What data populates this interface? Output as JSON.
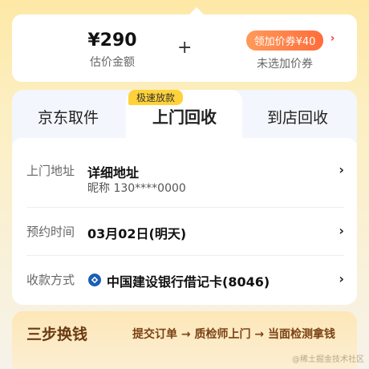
{
  "price": {
    "amount": "¥290",
    "amount_label": "估价金额",
    "plus": "+",
    "coupon_label": "领加价券¥40",
    "coupon_status": "未选加价券",
    "coupon_arrow": "›"
  },
  "tabs": [
    {
      "label": "京东取件"
    },
    {
      "label": "上门回收"
    },
    {
      "label": "到店回收"
    }
  ],
  "badge": "极速放款",
  "form": {
    "address": {
      "label": "上门地址",
      "value": "详细地址",
      "sub": "昵称 130****0000"
    },
    "time": {
      "label": "预约时间",
      "value": "03月02日(明天)"
    },
    "payment": {
      "label": "收款方式",
      "value": "中国建设银行借记卡(8046)"
    },
    "chevron": "›"
  },
  "steps": {
    "title": "三步换钱",
    "flow": "提交订单 → 质检师上门 → 当面检测拿钱"
  },
  "watermark": "@稀土掘金技术社区",
  "colors": {
    "accent": "#ff6d3b",
    "badge": "#ffd23a",
    "bank": "#1a5fb4"
  }
}
